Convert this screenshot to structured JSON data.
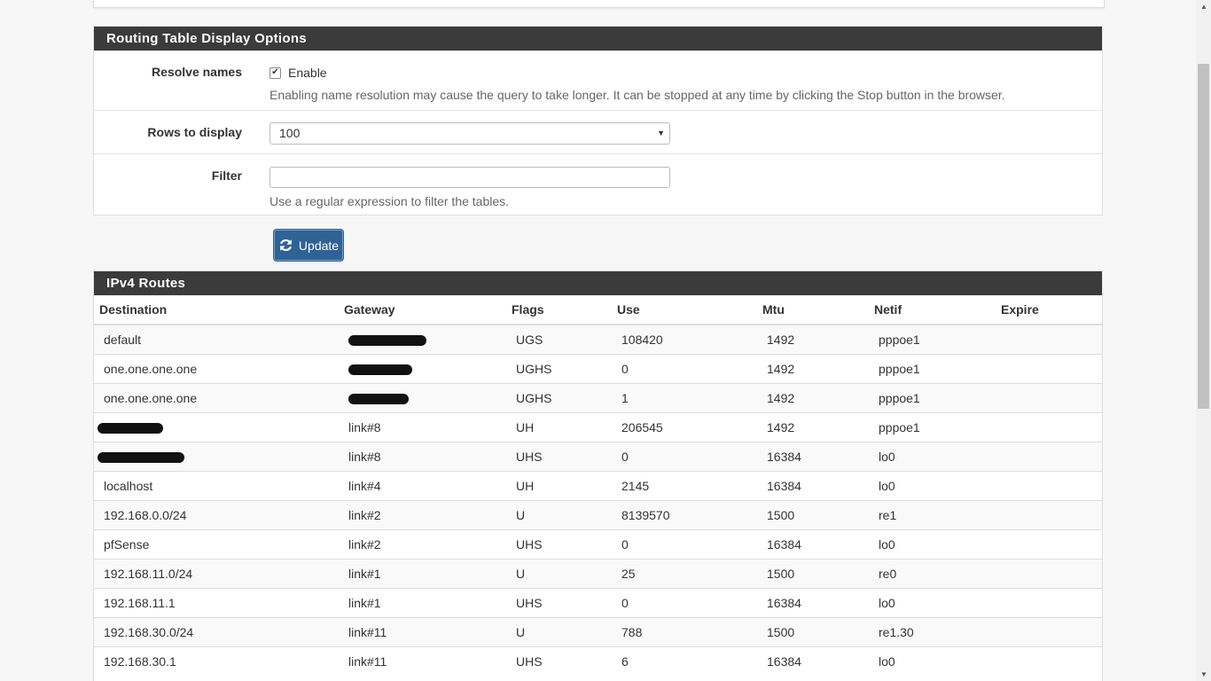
{
  "options_panel": {
    "title": "Routing Table Display Options",
    "resolve_label": "Resolve names",
    "enable_label": "Enable",
    "resolve_help": "Enabling name resolution may cause the query to take longer. It can be stopped at any time by clicking the Stop button in the browser.",
    "rows_label": "Rows to display",
    "rows_value": "100",
    "filter_label": "Filter",
    "filter_value": "",
    "filter_help": "Use a regular expression to filter the tables."
  },
  "update_button": {
    "label": "Update",
    "icon": "refresh-icon"
  },
  "routes_panel": {
    "title": "IPv4 Routes",
    "columns": [
      "Destination",
      "Gateway",
      "Flags",
      "Use",
      "Mtu",
      "Netif",
      "Expire"
    ],
    "rows": [
      [
        "default",
        "",
        "UGS",
        "108420",
        "1492",
        "pppoe1",
        ""
      ],
      [
        "one.one.one.one",
        "",
        "UGHS",
        "0",
        "1492",
        "pppoe1",
        ""
      ],
      [
        "one.one.one.one",
        "",
        "UGHS",
        "1",
        "1492",
        "pppoe1",
        ""
      ],
      [
        "",
        "link#8",
        "UH",
        "206545",
        "1492",
        "pppoe1",
        ""
      ],
      [
        "",
        "link#8",
        "UHS",
        "0",
        "16384",
        "lo0",
        ""
      ],
      [
        "localhost",
        "link#4",
        "UH",
        "2145",
        "16384",
        "lo0",
        ""
      ],
      [
        "192.168.0.0/24",
        "link#2",
        "U",
        "8139570",
        "1500",
        "re1",
        ""
      ],
      [
        "pfSense",
        "link#2",
        "UHS",
        "0",
        "16384",
        "lo0",
        ""
      ],
      [
        "192.168.11.0/24",
        "link#1",
        "U",
        "25",
        "1500",
        "re0",
        ""
      ],
      [
        "192.168.11.1",
        "link#1",
        "UHS",
        "0",
        "16384",
        "lo0",
        ""
      ],
      [
        "192.168.30.0/24",
        "link#11",
        "U",
        "788",
        "1500",
        "re1.30",
        ""
      ],
      [
        "192.168.30.1",
        "link#11",
        "UHS",
        "6",
        "16384",
        "lo0",
        ""
      ]
    ]
  }
}
